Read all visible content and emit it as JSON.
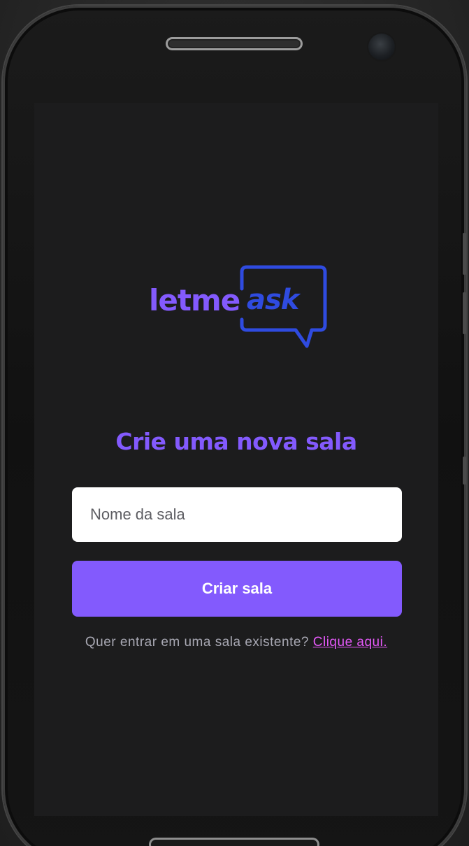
{
  "logo": {
    "primary_text": "letme",
    "accent_text": "ask"
  },
  "main": {
    "title": "Crie uma nova sala",
    "room_name_input": {
      "placeholder": "Nome da sala",
      "value": ""
    },
    "create_button_label": "Criar sala",
    "existing_room_prompt": "Quer entrar em uma sala existente?",
    "existing_room_link": "Clique aqui."
  },
  "colors": {
    "brand_purple": "#835afd",
    "brand_blue": "#2f4be0",
    "link_pink": "#e559f9",
    "screen_background": "#1c1c1d",
    "input_background": "#ffffff",
    "muted_text": "#a8a8b3"
  },
  "icons": {
    "logo_bubble": "speech-bubble-icon"
  }
}
